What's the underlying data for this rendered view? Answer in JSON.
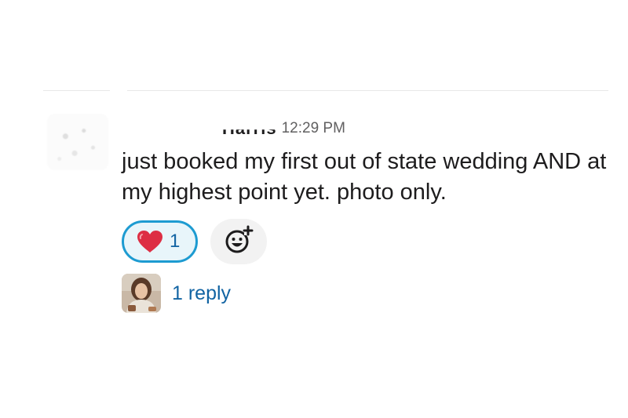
{
  "message": {
    "sender_name": "Harris",
    "timestamp": "12:29 PM",
    "text": "just booked my first out of state wedding AND at my highest point yet. photo only."
  },
  "reactions": [
    {
      "emoji": "red-heart",
      "count": "1",
      "selected": true
    }
  ],
  "add_reaction": {
    "icon": "add-emoji-icon"
  },
  "thread": {
    "reply_label": "1 reply"
  },
  "colors": {
    "accent": "#1d9bd1",
    "reaction_bg": "#e8f5fa",
    "link": "#1264a3",
    "text": "#1d1c1d",
    "muted": "#616061"
  }
}
